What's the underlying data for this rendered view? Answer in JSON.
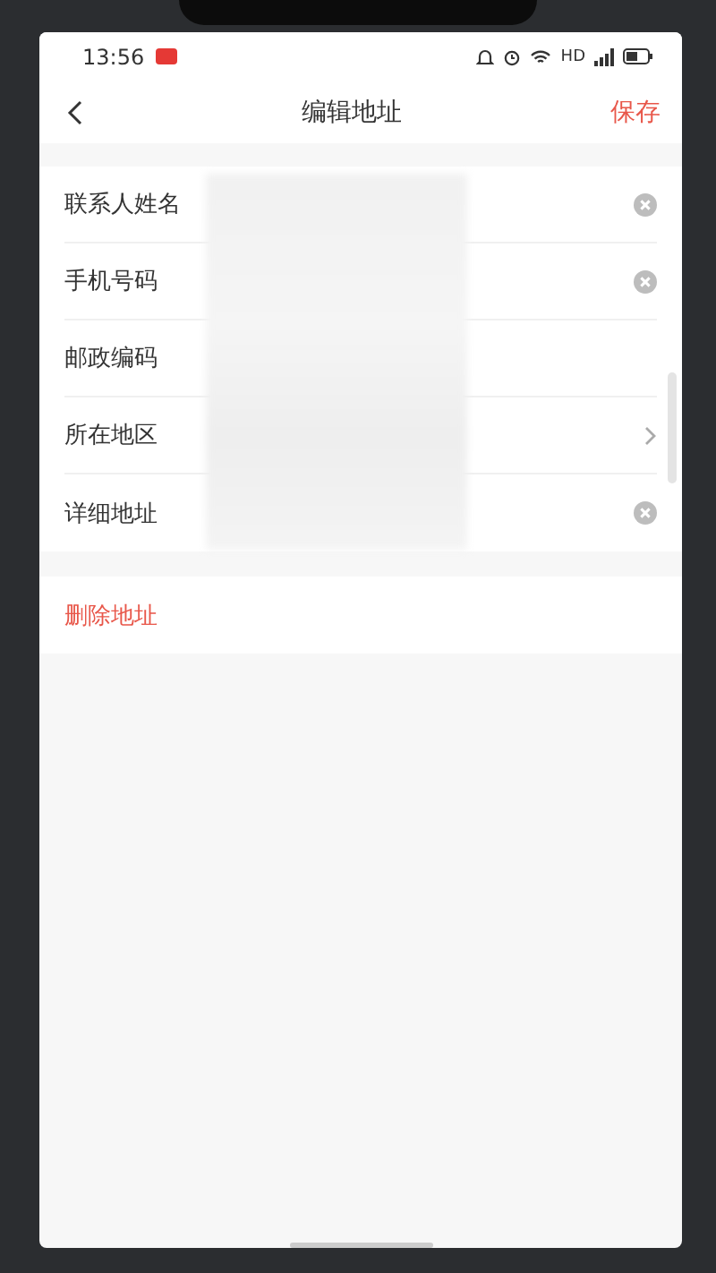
{
  "status_bar": {
    "time": "13:56",
    "network": "HD"
  },
  "header": {
    "title": "编辑地址",
    "action": "保存"
  },
  "fields": [
    {
      "label": "联系人姓名",
      "kind": "clear"
    },
    {
      "label": "手机号码",
      "kind": "clear"
    },
    {
      "label": "邮政编码",
      "kind": "plain"
    },
    {
      "label": "所在地区",
      "kind": "chevron"
    },
    {
      "label": "详细地址",
      "kind": "clear"
    }
  ],
  "redaction": {
    "kind": "blur"
  },
  "delete_action": "删除地址"
}
